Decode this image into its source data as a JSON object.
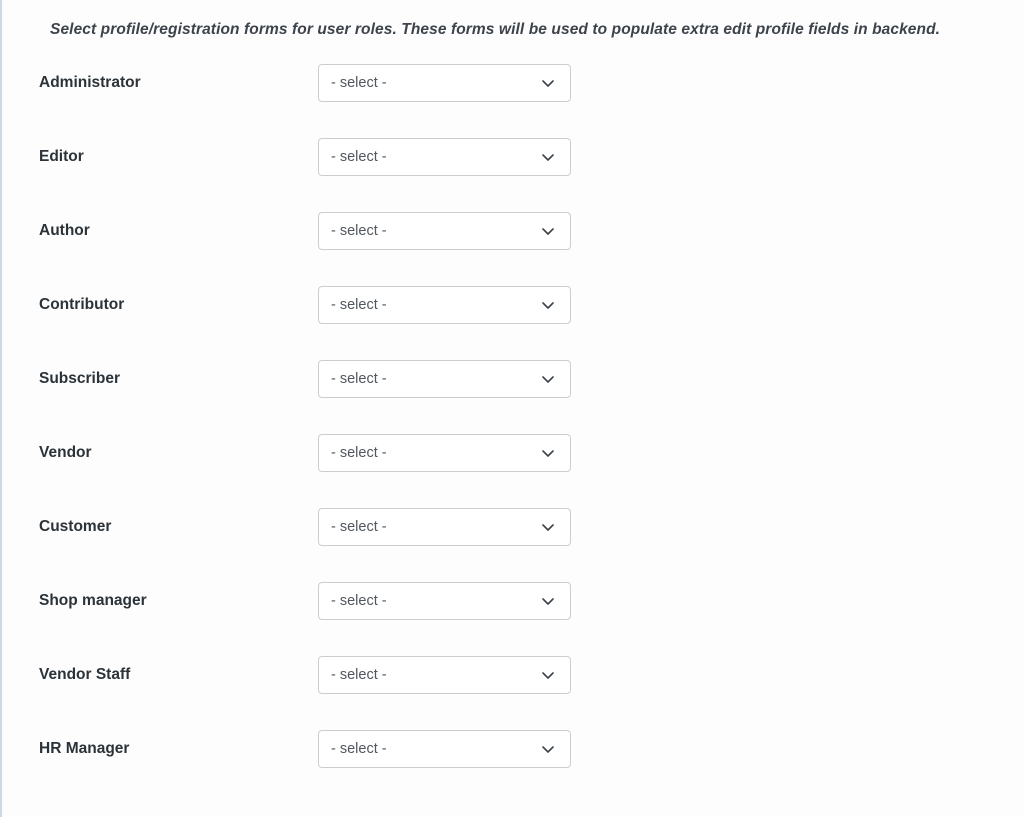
{
  "page": {
    "intro_text": "Select profile/registration forms for user roles. These forms will be used to populate extra edit profile fields in backend.",
    "label_color": "#2c3338",
    "intro_color": "#3c434a",
    "select_border_color": "#c9ced3",
    "select_text_color": "#50575e",
    "panel_background": "#fdfdfd",
    "left_rule_color": "#ced8e0"
  },
  "icons": {
    "chevron_down": "chevron-down-icon"
  },
  "roles": [
    {
      "label": "Administrator",
      "select_value": "- select -"
    },
    {
      "label": "Editor",
      "select_value": "- select -"
    },
    {
      "label": "Author",
      "select_value": "- select -"
    },
    {
      "label": "Contributor",
      "select_value": "- select -"
    },
    {
      "label": "Subscriber",
      "select_value": "- select -"
    },
    {
      "label": "Vendor",
      "select_value": "- select -"
    },
    {
      "label": "Customer",
      "select_value": "- select -"
    },
    {
      "label": "Shop manager",
      "select_value": "- select -"
    },
    {
      "label": "Vendor Staff",
      "select_value": "- select -"
    },
    {
      "label": "HR Manager",
      "select_value": "- select -"
    }
  ]
}
